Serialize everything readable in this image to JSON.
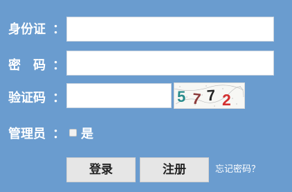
{
  "form": {
    "id_card_label": "身份证",
    "password_label": "密　码",
    "captcha_label": "验证码",
    "admin_label": "管理员",
    "colon": "：",
    "id_card_value": "",
    "password_value": "",
    "captcha_value": "",
    "admin_checked": false,
    "admin_option_label": "是"
  },
  "captcha_image": {
    "characters": [
      "5",
      "7",
      "7",
      "2"
    ],
    "colors": [
      "#2a8c8c",
      "#8c3a3a",
      "#222222",
      "#d43030"
    ]
  },
  "actions": {
    "login_label": "登录",
    "register_label": "注册",
    "forgot_password_label": "忘记密码？"
  },
  "colors": {
    "background": "#6a9ccf",
    "text": "#ffffff",
    "button_bg": "#e6e6e6"
  }
}
